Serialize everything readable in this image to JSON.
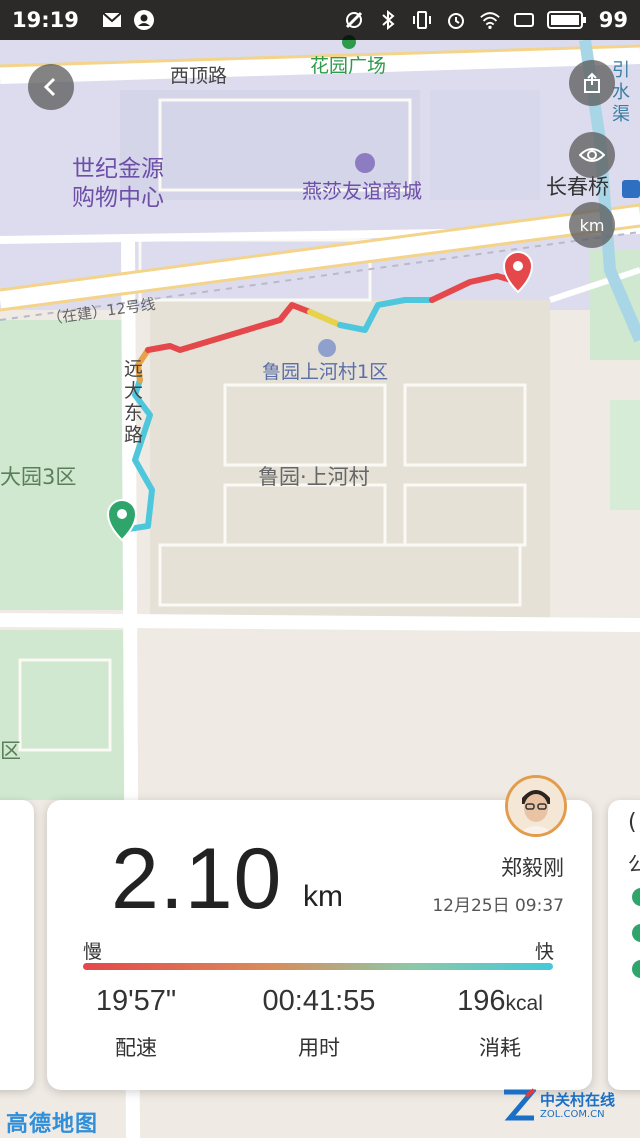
{
  "status_bar": {
    "time": "19:19",
    "battery": "99",
    "icons": [
      "mail-icon",
      "account-icon",
      "nfc-icon",
      "bluetooth-icon",
      "vibrate-icon",
      "alarm-icon",
      "wifi-icon",
      "screen-icon",
      "battery-icon"
    ]
  },
  "map": {
    "labels": {
      "west_road": "西顶路",
      "garden_square": "花园广场",
      "century_mall_line1": "世纪金源",
      "century_mall_line2": "购物中心",
      "yansha": "燕莎友谊商城",
      "changchun_bridge": "长春桥",
      "line12": "（在建）12号线",
      "luyuan_district1": "鲁园上河村1区",
      "luyuan": "鲁园·上河村",
      "park3": "大园3区",
      "yuanda_road_v": "远大东路",
      "district_partial": "区",
      "water_canal": "引水渠"
    },
    "route_colors": {
      "slow": "#e4484b",
      "medium": "#e7d34a",
      "fast": "#4ec7dc"
    },
    "buttons": {
      "back": "back-icon",
      "share": "share-icon",
      "visibility": "eye-icon",
      "km_marker_label": "km"
    }
  },
  "run_card": {
    "distance": "2.10",
    "distance_unit": "km",
    "user_name": "郑毅刚",
    "datetime": "12月25日  09:37",
    "speed_slow": "慢",
    "speed_fast": "快",
    "pace_value": "19'57\"",
    "pace_label": "配速",
    "duration_value": "00:41:55",
    "duration_label": "用时",
    "calories_value": "196",
    "calories_unit": "kcal",
    "calories_label": "消耗"
  },
  "footer": {
    "amap_logo": "高德地图",
    "zol_cn": "中关村在线",
    "zol_en": "ZOL.COM.CN"
  },
  "right_card_partial": {
    "char": "公"
  }
}
